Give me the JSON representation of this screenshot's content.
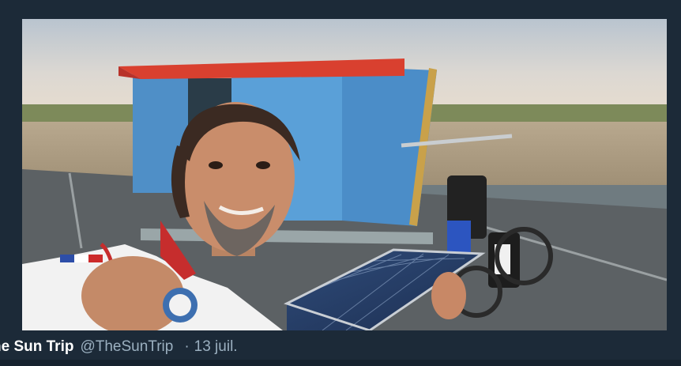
{
  "tweet": {
    "display_name": "he Sun Trip",
    "handle": "@TheSunTrip",
    "separator": "·",
    "date": "13 juil."
  },
  "media": {
    "icon": "photo-icon"
  }
}
